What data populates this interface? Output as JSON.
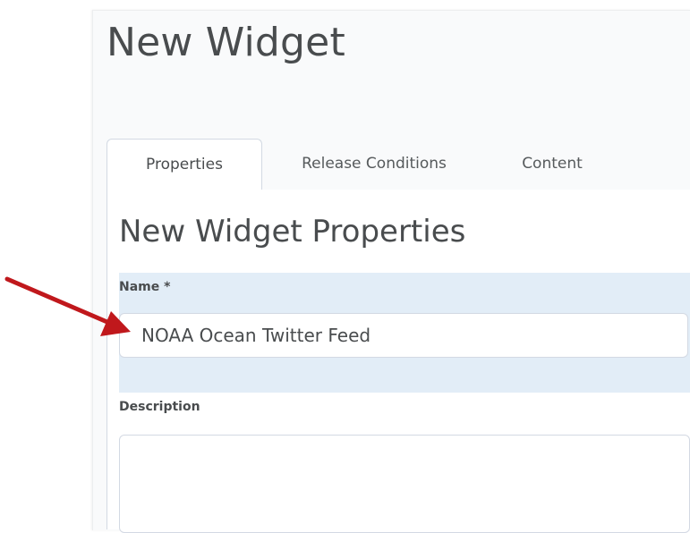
{
  "page": {
    "title": "New Widget"
  },
  "tabs": [
    {
      "label": "Properties",
      "active": true
    },
    {
      "label": "Release Conditions",
      "active": false
    },
    {
      "label": "Content",
      "active": false
    }
  ],
  "form": {
    "section_title": "New Widget Properties",
    "name_label": "Name *",
    "name_value": "NOAA Ocean Twitter Feed",
    "description_label": "Description",
    "description_value": ""
  },
  "annotation": {
    "arrow_color": "#c0181c",
    "arrow_icon": "arrow-pointer-icon"
  },
  "colors": {
    "highlight_band": "#e2edf7",
    "text": "#494c4e",
    "border": "#d3d9e3"
  }
}
